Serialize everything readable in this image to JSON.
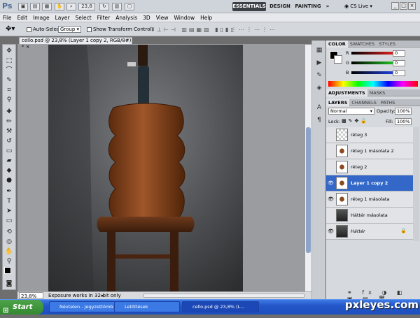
{
  "app": {
    "logo": "Ps",
    "zoom": "23,8",
    "workspace": [
      "ESSENTIALS",
      "DESIGN",
      "PAINTING"
    ],
    "more": "»",
    "cslive": "CS Live"
  },
  "menu": [
    "File",
    "Edit",
    "Image",
    "Layer",
    "Select",
    "Filter",
    "Analysis",
    "3D",
    "View",
    "Window",
    "Help"
  ],
  "options": {
    "auto_select": "Auto-Select:",
    "group": "Group",
    "show_transform": "Show Transform Controls"
  },
  "document": {
    "tab": "cello.psd @ 23,8% (Layer 1 copy 2, RGB/8#) *",
    "zoom": "23,8%",
    "status": "Exposure works in 32-bit only"
  },
  "color_panel": {
    "tabs": [
      "COLOR",
      "SWATCHES",
      "STYLES"
    ],
    "channels": [
      {
        "label": "R",
        "value": "0",
        "color": "#e02020"
      },
      {
        "label": "G",
        "value": "0",
        "color": "#20c020"
      },
      {
        "label": "B",
        "value": "0",
        "color": "#2040e0"
      }
    ]
  },
  "adjust_tabs": [
    "ADJUSTMENTS",
    "MASKS"
  ],
  "layers_panel": {
    "tabs": [
      "LAYERS",
      "CHANNELS",
      "PATHS"
    ],
    "blend": "Normal",
    "opacity_label": "Opacity:",
    "opacity": "100%",
    "lock_label": "Lock:",
    "fill_label": "Fill:",
    "fill": "100%",
    "layers": [
      {
        "name": "réteg 3",
        "visible": false,
        "selected": false
      },
      {
        "name": "réteg 1 másolata 2",
        "visible": false,
        "selected": false
      },
      {
        "name": "réteg 2",
        "visible": false,
        "selected": false
      },
      {
        "name": "Layer 1 copy 2",
        "visible": true,
        "selected": true
      },
      {
        "name": "réteg 1 másolata",
        "visible": true,
        "selected": false
      },
      {
        "name": "Háttér másolata",
        "visible": false,
        "selected": false
      },
      {
        "name": "Háttér",
        "visible": true,
        "selected": false
      }
    ]
  },
  "taskbar": {
    "start": "Start",
    "tasks": [
      "Névtelen - Jegyzettömb",
      "Letöltések",
      "cello.psd @ 23,8% (L..."
    ]
  },
  "watermark": "pxleyes.com"
}
